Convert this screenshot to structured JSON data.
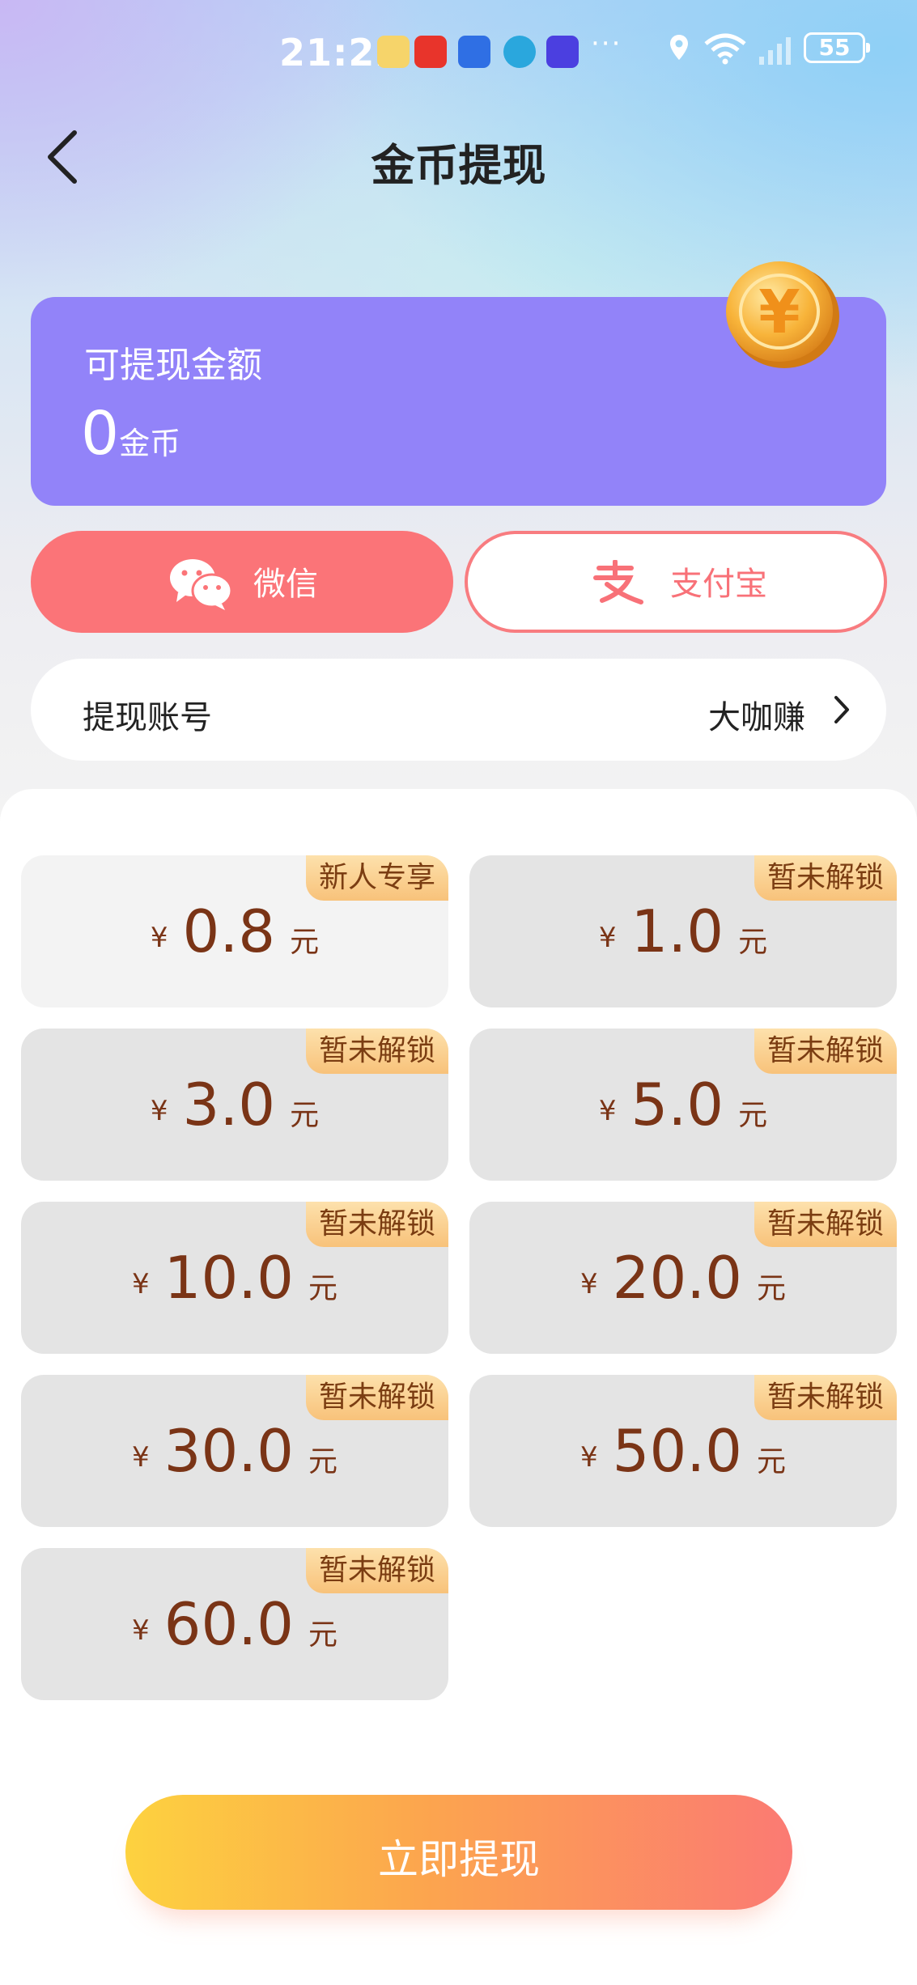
{
  "status_bar": {
    "time": "21:22",
    "dots": "···",
    "battery": "55"
  },
  "header": {
    "title": "金币提现"
  },
  "balance": {
    "label": "可提现金额",
    "amount": "0",
    "unit": "金币"
  },
  "payment": {
    "wechat_label": "微信",
    "alipay_label": "支付宝",
    "selected": "wechat"
  },
  "account": {
    "label": "提现账号",
    "value": "大咖赚"
  },
  "options": [
    {
      "amount": "0.8",
      "badge": "新人专享",
      "selected": true
    },
    {
      "amount": "1.0",
      "badge": "暂未解锁",
      "selected": false
    },
    {
      "amount": "3.0",
      "badge": "暂未解锁",
      "selected": false
    },
    {
      "amount": "5.0",
      "badge": "暂未解锁",
      "selected": false
    },
    {
      "amount": "10.0",
      "badge": "暂未解锁",
      "selected": false
    },
    {
      "amount": "20.0",
      "badge": "暂未解锁",
      "selected": false
    },
    {
      "amount": "30.0",
      "badge": "暂未解锁",
      "selected": false
    },
    {
      "amount": "50.0",
      "badge": "暂未解锁",
      "selected": false
    },
    {
      "amount": "60.0",
      "badge": "暂未解锁",
      "selected": false
    }
  ],
  "currency_symbol": "¥",
  "currency_unit": "元",
  "cta": {
    "label": "立即提现"
  },
  "colors": {
    "accent_purple": "#9283f9",
    "wechat_red": "#fb7478",
    "price_brown": "#7a3416"
  }
}
